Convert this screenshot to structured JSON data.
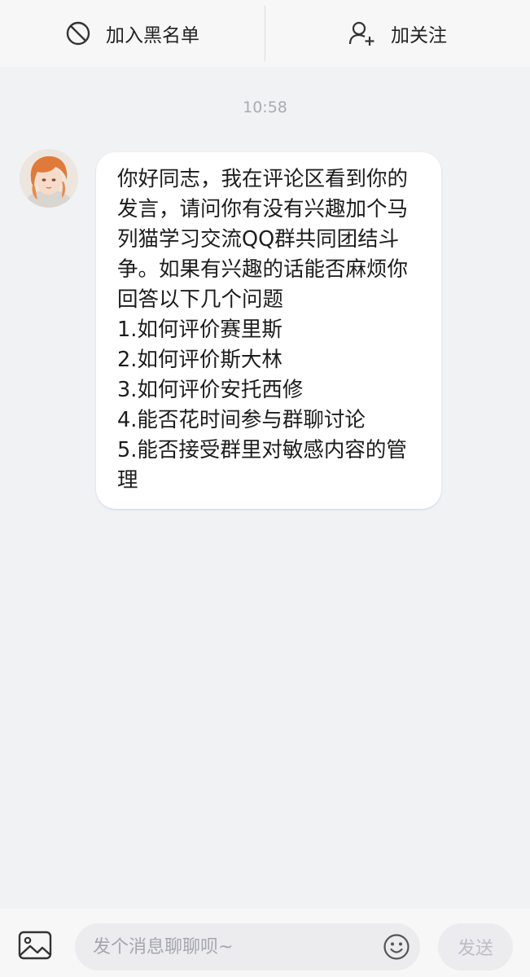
{
  "header": {
    "block_label": "加入黑名单",
    "block_icon": "block-icon",
    "follow_label": "加关注",
    "follow_icon": "add-user-icon"
  },
  "chat": {
    "timestamp": "10:58",
    "messages": [
      {
        "sender": "other",
        "avatar_icon": "avatar-anime-character",
        "text": "你好同志，我在评论区看到你的发言，请问你有没有兴趣加个马列猫学习交流QQ群共同团结斗争。如果有兴趣的话能否麻烦你回答以下几个问题\n1.如何评价赛里斯\n2.如何评价斯大林\n3.如何评价安托西修\n4.能否花时间参与群聊讨论\n5.能否接受群里对敏感内容的管理"
      }
    ]
  },
  "composer": {
    "image_icon": "image-icon",
    "placeholder": "发个消息聊聊呗~",
    "value": "",
    "emoji_icon": "emoji-icon",
    "send_label": "发送"
  },
  "colors": {
    "background": "#f1f2f4",
    "bar": "#f7f7f8",
    "bubble": "#ffffff",
    "muted_text": "#a9abaf"
  }
}
